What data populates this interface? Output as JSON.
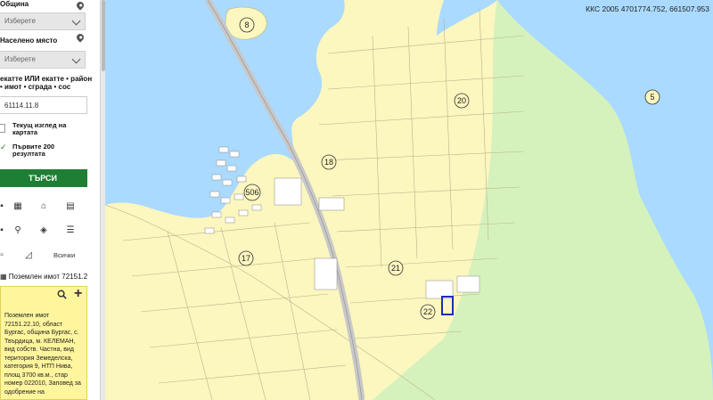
{
  "sidebar": {
    "municipality_label": "Община",
    "municipality_select": "Изберете",
    "settlement_label": "Населено място",
    "settlement_select": "Изберете",
    "search_hint": "екатте ИЛИ екатте • район • имот • сграда • сос",
    "search_value": "61114.11.8",
    "option_current_view": "Текущ изглед на картата",
    "option_first_200": "Първите 200 резултата",
    "search_button": "ТЪРСИ",
    "tool_all_label": "Всички",
    "parcel_header": "Поземлен имот 72151.2",
    "parcel_info": "Поземлен имот 72151.22.10, област Бургас, община Бургас, с. Твърдица, м. КЕЛЕМАН, вид собств. Частна, вид територия Земеделска, категория 9, НТП Нива, площ 3700 кв.м., стар номер 022010, Заповед за одобрение на"
  },
  "map": {
    "coordinates": "ККС 2005 4701774.752, 661507.953",
    "area_labels": [
      "8",
      "5",
      "20",
      "18",
      "506",
      "17",
      "21",
      "22"
    ],
    "colors": {
      "water": "#aadaff",
      "land": "#fcf6bf",
      "green": "#d6f2bc",
      "road": "#c8c8c8",
      "highlight": "#1a2fb5"
    }
  },
  "icons": [
    "chevron-down-icon",
    "location-pin-icon",
    "grid-icon",
    "home-icon",
    "layers-icon",
    "search-icon",
    "plus-icon"
  ]
}
